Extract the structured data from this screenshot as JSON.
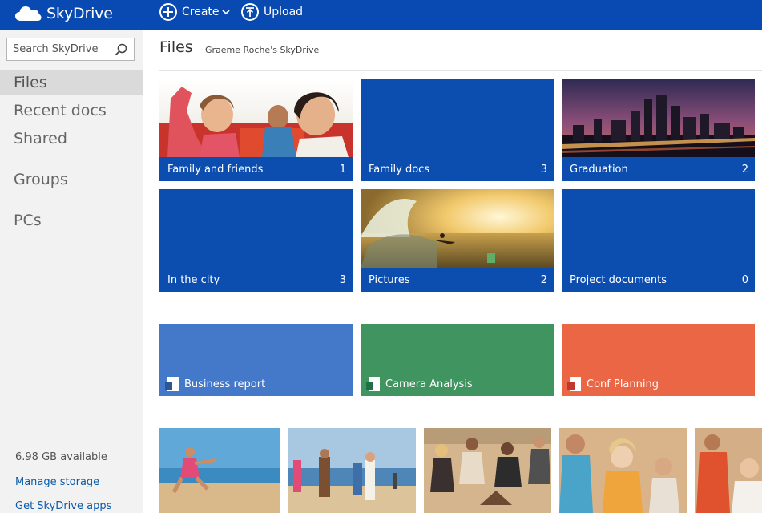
{
  "app": {
    "name": "SkyDrive"
  },
  "toolbar": {
    "create_label": "Create",
    "upload_label": "Upload"
  },
  "search": {
    "placeholder": "Search SkyDrive"
  },
  "sidebar": {
    "items": [
      {
        "label": "Files",
        "active": true
      },
      {
        "label": "Recent docs"
      },
      {
        "label": "Shared"
      },
      {
        "label": "Groups"
      },
      {
        "label": "PCs"
      }
    ],
    "storage": "6.98 GB available",
    "manage_storage": "Manage storage",
    "get_apps": "Get SkyDrive apps"
  },
  "main": {
    "title": "Files",
    "breadcrumb": "Graeme Roche's SkyDrive"
  },
  "folders": [
    {
      "name": "Family and friends",
      "count": "1",
      "thumbnail": "photo-people-ride"
    },
    {
      "name": "Family docs",
      "count": "3"
    },
    {
      "name": "Graduation",
      "count": "2",
      "thumbnail": "photo-city-night"
    },
    {
      "name": "In the city",
      "count": "3"
    },
    {
      "name": "Pictures",
      "count": "2",
      "thumbnail": "photo-surf-sunset"
    },
    {
      "name": "Project documents",
      "count": "0"
    }
  ],
  "documents": [
    {
      "name": "Business report",
      "type": "word",
      "icon": "word-doc-icon",
      "color": "#4478c8"
    },
    {
      "name": "Camera Analysis",
      "type": "excel",
      "icon": "excel-doc-icon",
      "color": "#409460"
    },
    {
      "name": "Conf Planning",
      "type": "powerpoint",
      "icon": "powerpoint-doc-icon",
      "color": "#ea6644"
    }
  ],
  "photos": [
    "beach-run-photo",
    "beach-group-photo",
    "beach-campfire-photo",
    "beach-friends-photo",
    "beach-partial-photo"
  ],
  "colors": {
    "brand": "#094ab2",
    "folder": "#0c4db0",
    "link": "#0a5aa8",
    "sidebar": "#f2f2f2"
  }
}
